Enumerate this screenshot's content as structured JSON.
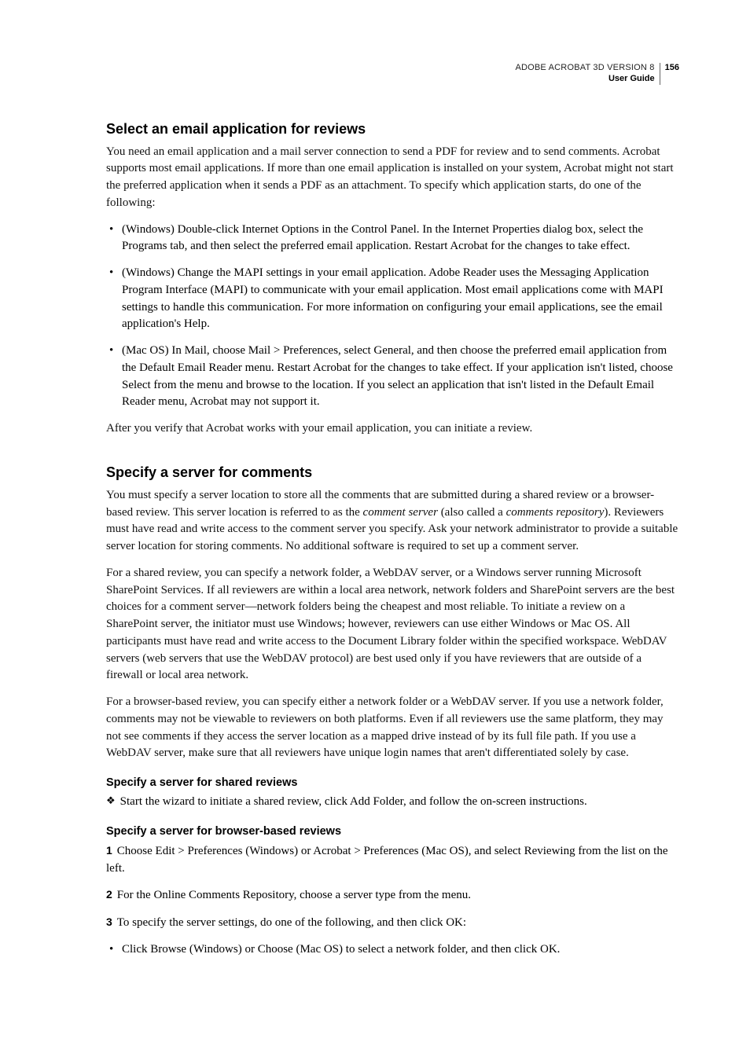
{
  "header": {
    "title": "ADOBE ACROBAT 3D VERSION 8",
    "subtitle": "User Guide",
    "page": "156"
  },
  "section1": {
    "heading": "Select an email application for reviews",
    "intro": "You need an email application and a mail server connection to send a PDF for review and to send comments. Acrobat supports most email applications. If more than one email application is installed on your system, Acrobat might not start the preferred application when it sends a PDF as an attachment. To specify which application starts, do one of the following:",
    "bullets": [
      "(Windows) Double-click Internet Options in the Control Panel. In the Internet Properties dialog box, select the Programs tab, and then select the preferred email application. Restart Acrobat for the changes to take effect.",
      "(Windows) Change the MAPI settings in your email application. Adobe Reader uses the Messaging Application Program Interface (MAPI) to communicate with your email application. Most email applications come with MAPI settings to handle this communication. For more information on configuring your email applications, see the email application's Help.",
      "(Mac OS) In Mail, choose Mail > Preferences, select General, and then choose the preferred email application from the Default Email Reader menu. Restart Acrobat for the changes to take effect. If your application isn't listed, choose Select from the menu and browse to the location. If you select an application that isn't listed in the Default Email Reader menu, Acrobat may not support it."
    ],
    "after": "After you verify that Acrobat works with your email application, you can initiate a review."
  },
  "section2": {
    "heading": "Specify a server for comments",
    "p1_a": "You must specify a server location to store all the comments that are submitted during a shared review or a browser-based review. This server location is referred to as the ",
    "p1_i1": "comment server",
    "p1_b": " (also called a ",
    "p1_i2": "comments repository",
    "p1_c": "). Reviewers must have read and write access to the comment server you specify. Ask your network administrator to provide a suitable server location for storing comments. No additional software is required to set up a comment server.",
    "p2": "For a shared review, you can specify a network folder, a WebDAV server, or a Windows server running Microsoft SharePoint Services. If all reviewers are within a local area network, network folders and SharePoint servers are the best choices for a comment server—network folders being the cheapest and most reliable. To initiate a review on a SharePoint server, the initiator must use Windows; however, reviewers can use either Windows or Mac OS. All participants must have read and write access to the Document Library folder within the specified workspace. WebDAV servers (web servers that use the WebDAV protocol) are best used only if you have reviewers that are outside of a firewall or local area network.",
    "p3": "For a browser-based review, you can specify either a network folder or a WebDAV server. If you use a network folder, comments may not be viewable to reviewers on both platforms. Even if all reviewers use the same platform, they may not see comments if they access the server location as a mapped drive instead of by its full file path. If you use a WebDAV server, make sure that all reviewers have unique login names that aren't differentiated solely by case.",
    "sub1_heading": "Specify a server for shared reviews",
    "sub1_line": "Start the wizard to initiate a shared review, click Add Folder, and follow the on-screen instructions.",
    "sub2_heading": "Specify a server for browser-based reviews",
    "steps": {
      "s1": "Choose Edit > Preferences (Windows) or Acrobat > Preferences (Mac OS), and select Reviewing from the list on the left.",
      "s2": "For the Online Comments Repository, choose a server type from the menu.",
      "s3": "To specify the server settings, do one of the following, and then click OK:",
      "s3_bullet": "Click Browse (Windows) or Choose (Mac OS) to select a network folder, and then click OK."
    },
    "nums": {
      "n1": "1",
      "n2": "2",
      "n3": "3"
    }
  }
}
